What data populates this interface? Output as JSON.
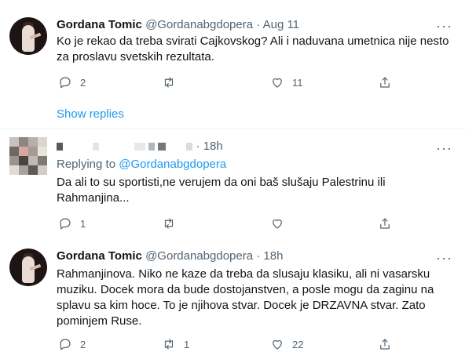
{
  "tweets": [
    {
      "name": "Gordana Tomic",
      "handle": "@Gordanabgdopera",
      "dot": "·",
      "time": "Aug 11",
      "text": "Ko je rekao da treba svirati Cajkovskog? Ali i naduvana umetnica nije nesto za proslavu svetskih rezultata.",
      "replies": "2",
      "retweets": "",
      "likes": "11"
    },
    {
      "name": "",
      "handle": "",
      "dot": "·",
      "time": "18h",
      "replying_prefix": "Replying to",
      "replying_to": "@Gordanabgdopera",
      "text": "Da ali to su sportisti,ne verujem da oni baš slušaju Palestrinu ili Rahmanjina...",
      "replies": "1",
      "retweets": "",
      "likes": ""
    },
    {
      "name": "Gordana Tomic",
      "handle": "@Gordanabgdopera",
      "dot": "·",
      "time": "18h",
      "text": "Rahmanjinova. Niko ne kaze da treba da slusaju klasiku, ali ni vasarsku muziku. Docek mora da bude dostojanstven, a posle mogu da zaginu na splavu sa kim hoce. To je njihova stvar. Docek je DRZAVNA stvar. Zato pominjem Ruse.",
      "replies": "2",
      "retweets": "1",
      "likes": "22"
    }
  ],
  "show_replies": "Show replies",
  "more_label": "···",
  "colors": {
    "accent": "#1d9bf0",
    "secondary": "#536471",
    "text": "#0f1419",
    "divider": "#eff3f4"
  },
  "icons": [
    "reply-icon",
    "retweet-icon",
    "like-icon",
    "share-icon",
    "more-icon"
  ]
}
